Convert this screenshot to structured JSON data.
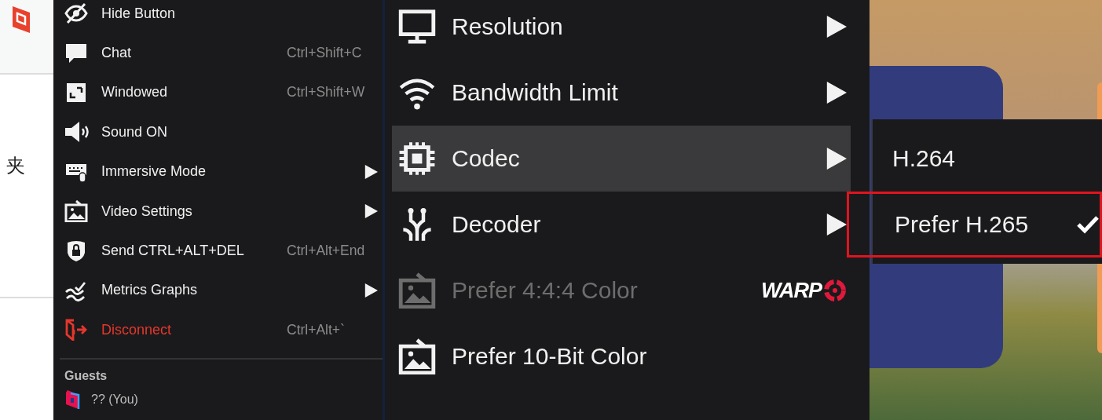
{
  "app_strip": {
    "text": "夹"
  },
  "main_menu": {
    "items": [
      {
        "label": "Hide Button",
        "submenu": false,
        "kind": "normal"
      },
      {
        "label": "Chat",
        "shortcut": "Ctrl+Shift+C",
        "submenu": false,
        "kind": "normal"
      },
      {
        "label": "Windowed",
        "shortcut": "Ctrl+Shift+W",
        "submenu": false,
        "kind": "normal"
      },
      {
        "label": "Sound ON",
        "submenu": false,
        "kind": "normal"
      },
      {
        "label": "Immersive Mode",
        "submenu": true,
        "kind": "normal"
      },
      {
        "label": "Video Settings",
        "submenu": true,
        "kind": "normal"
      },
      {
        "label": "Send CTRL+ALT+DEL",
        "shortcut": "Ctrl+Alt+End",
        "submenu": false,
        "kind": "normal"
      },
      {
        "label": "Metrics Graphs",
        "submenu": true,
        "kind": "normal"
      },
      {
        "label": "Disconnect",
        "shortcut": "Ctrl+Alt+`",
        "submenu": false,
        "kind": "danger"
      }
    ],
    "guests": {
      "heading": "Guests",
      "members": [
        {
          "name": "?? (You)"
        }
      ]
    }
  },
  "video_menu": {
    "items": [
      {
        "label": "Resolution",
        "submenu": true,
        "selected": false,
        "disabled": false
      },
      {
        "label": "Bandwidth Limit",
        "submenu": true,
        "selected": false,
        "disabled": false
      },
      {
        "label": "Codec",
        "submenu": true,
        "selected": true,
        "disabled": false
      },
      {
        "label": "Decoder",
        "submenu": true,
        "selected": false,
        "disabled": false
      },
      {
        "label": "Prefer 4:4:4 Color",
        "submenu": false,
        "selected": false,
        "disabled": true,
        "badge": "WARP"
      },
      {
        "label": "Prefer 10-Bit Color",
        "submenu": false,
        "selected": false,
        "disabled": false
      }
    ]
  },
  "codec_menu": {
    "items": [
      {
        "label": "H.264",
        "checked": false,
        "highlighted": false
      },
      {
        "label": "Prefer H.265",
        "checked": true,
        "highlighted": true
      }
    ]
  }
}
